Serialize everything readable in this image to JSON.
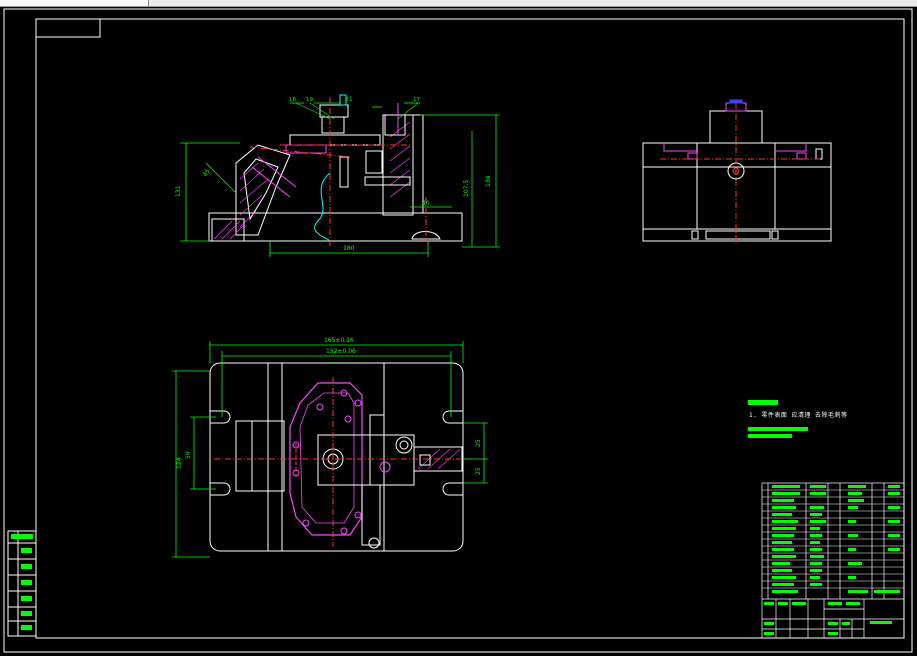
{
  "colors": {
    "background": "#000000",
    "frame": "#ffffff",
    "part": "#ffffff",
    "dimension": "#00ff00",
    "centerline": "#ff3030",
    "hidden": "#ff44ff",
    "highlight": "#00ffff",
    "block": "#00ff00"
  },
  "front_view": {
    "balloons": [
      "18",
      "19",
      "17"
    ],
    "dims": {
      "height_left": "131",
      "height_right": "134",
      "height_inner": "107.5",
      "width_bottom": "180",
      "small_top": "21",
      "small_mid": "40",
      "angle": "45"
    }
  },
  "top_view": {
    "dims": {
      "overall_width": "165±0.16",
      "inner_width": "152±0.06",
      "height_outer": "124",
      "height_inner": "59",
      "right_upper": "25",
      "right_lower": "25"
    }
  },
  "notes": {
    "text": "1. 零件表面 应清理 去除毛刺等"
  }
}
